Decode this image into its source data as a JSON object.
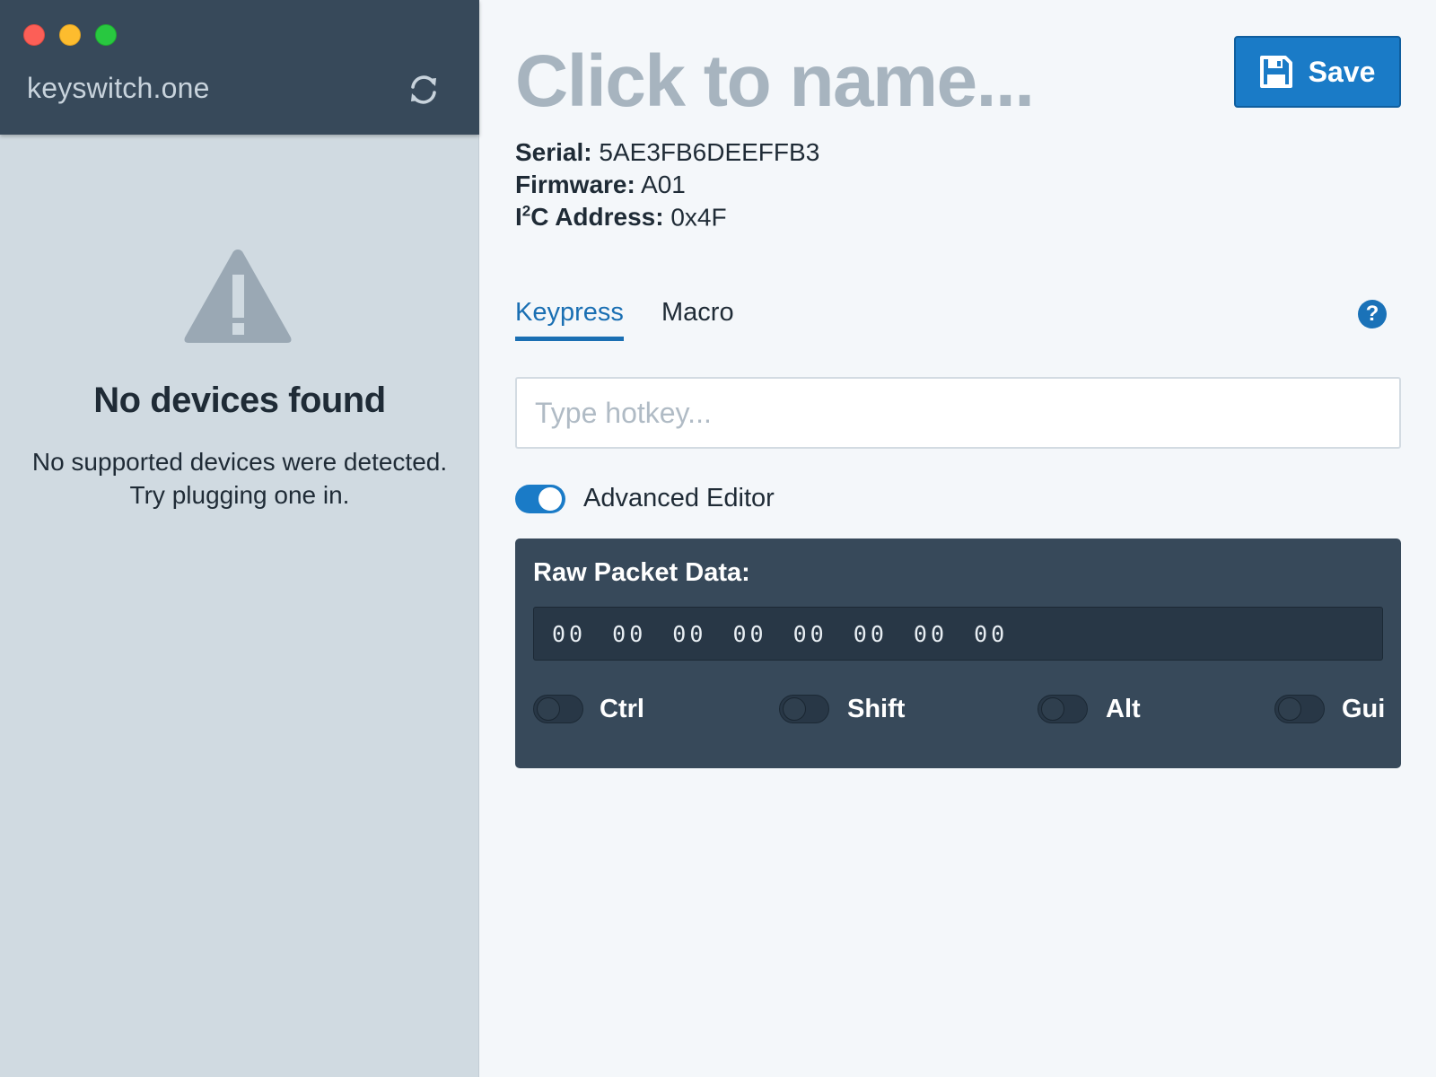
{
  "sidebar": {
    "app_title": "keyswitch.one",
    "empty_title": "No devices found",
    "empty_line1": "No supported devices were detected.",
    "empty_line2": "Try plugging one in."
  },
  "device": {
    "name_placeholder": "Click to name...",
    "serial_label": "Serial:",
    "serial": "5AE3FB6DEEFFB3",
    "firmware_label": "Firmware:",
    "firmware": "A01",
    "i2c_label_prefix": "I",
    "i2c_label_sup": "2",
    "i2c_label_suffix": "C Address:",
    "i2c": "0x4F"
  },
  "toolbar": {
    "save_label": "Save"
  },
  "tabs": [
    {
      "label": "Keypress",
      "active": true
    },
    {
      "label": "Macro",
      "active": false
    }
  ],
  "help_glyph": "?",
  "hotkey": {
    "placeholder": "Type hotkey...",
    "value": ""
  },
  "advanced": {
    "label": "Advanced Editor",
    "enabled": true
  },
  "raw": {
    "label": "Raw Packet Data:",
    "bytes": "00 00 00 00 00 00 00 00",
    "modifiers": [
      {
        "label": "Ctrl",
        "on": false
      },
      {
        "label": "Shift",
        "on": false
      },
      {
        "label": "Alt",
        "on": false
      },
      {
        "label": "Gui",
        "on": false
      }
    ]
  },
  "colors": {
    "accent": "#1a7bc7",
    "sidebar_header": "#37495a",
    "sidebar_bg": "#d0dae1",
    "panel": "#37495a"
  },
  "icons": [
    "refresh-icon",
    "warning-icon",
    "save-icon",
    "help-icon"
  ]
}
